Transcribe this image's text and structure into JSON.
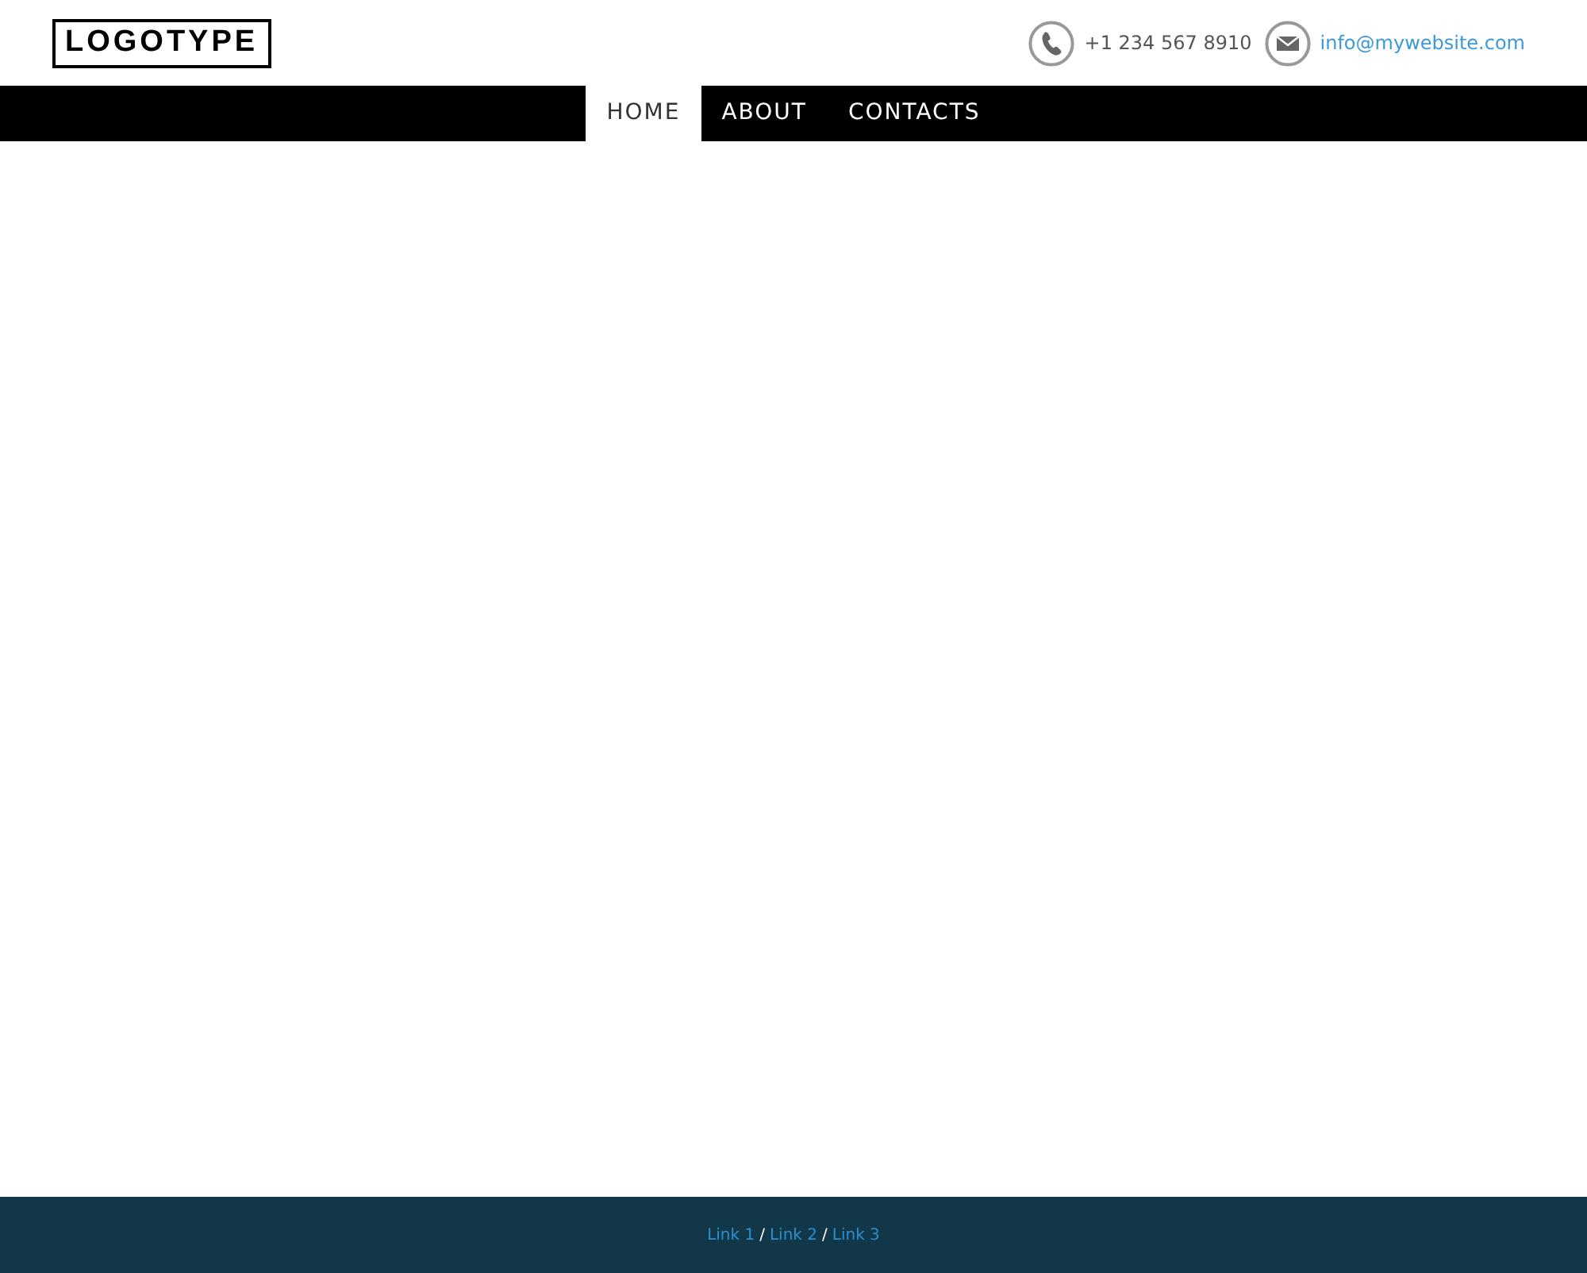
{
  "header": {
    "logo": "LOGOTYPE",
    "phone": "+1 234 567 8910",
    "email": "info@mywebsite.com"
  },
  "nav": [
    {
      "label": "HOME",
      "selected": true
    },
    {
      "label": "ABOUT",
      "selected": false
    },
    {
      "label": "CONTACTS",
      "selected": false
    }
  ],
  "footer": {
    "links": [
      "Link 1",
      "Link 2",
      "Link 3"
    ],
    "separator": "/"
  }
}
